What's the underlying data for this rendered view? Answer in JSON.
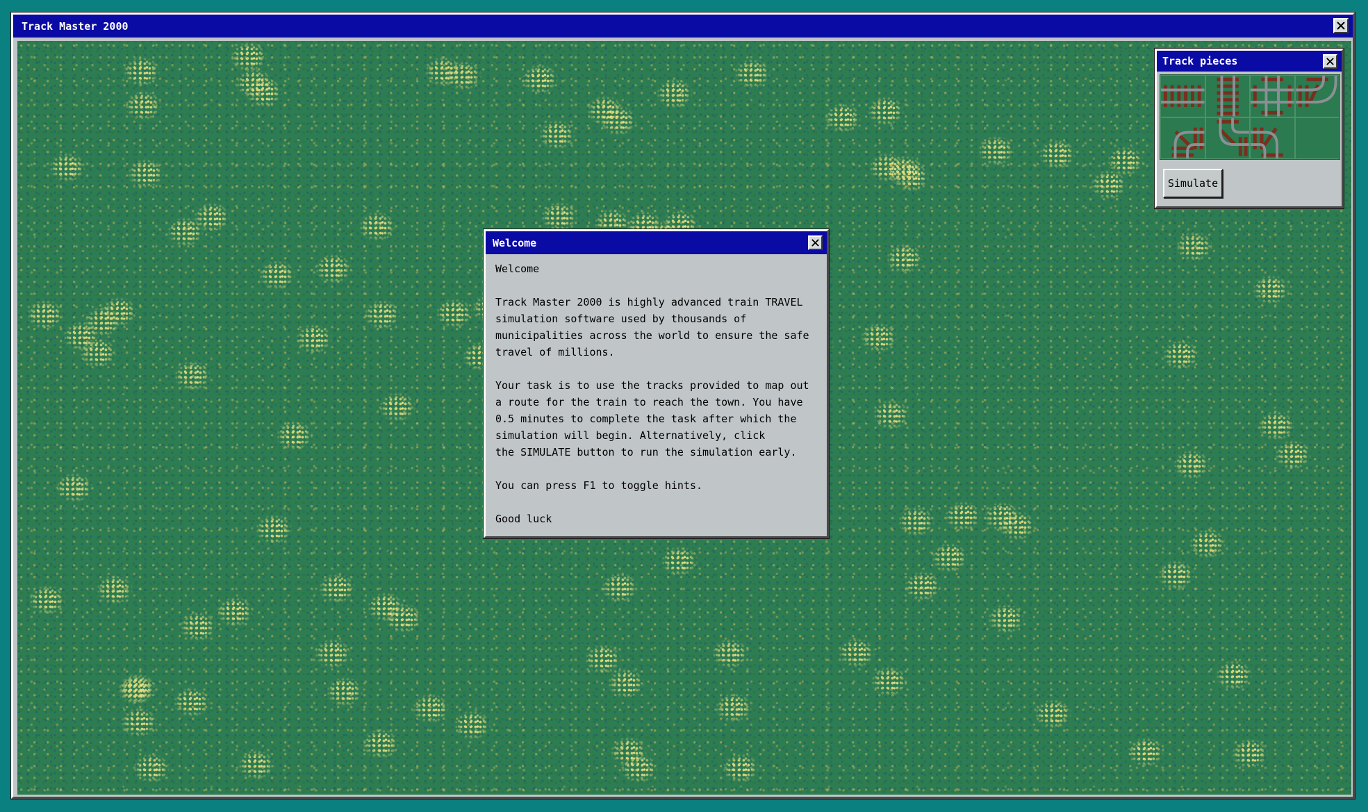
{
  "main_window": {
    "title": "Track Master 2000"
  },
  "palette": {
    "title": "Track pieces",
    "pieces": [
      {
        "name": "horizontal-track"
      },
      {
        "name": "vertical-track"
      },
      {
        "name": "cross-track"
      },
      {
        "name": "curve-left-down-track"
      },
      {
        "name": "curve-right-up-track"
      },
      {
        "name": "curve-up-right-track"
      },
      {
        "name": "curve-left-up-track"
      },
      {
        "name": "empty-slot"
      }
    ],
    "simulate_label": "Simulate"
  },
  "welcome_dialog": {
    "title": "Welcome",
    "paragraphs": [
      "Welcome",
      "Track Master 2000 is highly advanced train TRAVEL\nsimulation software used by thousands of\nmunicipalities across the world to ensure the safe\ntravel of millions.",
      "Your task is to use the tracks provided to map out\na route for the train to reach the town. You have\n0.5 minutes to complete the task after which the\nsimulation will begin. Alternatively, click\nthe SIMULATE button to run the simulation early.",
      "You can press F1 to toggle hints.",
      "Good luck"
    ]
  },
  "colors": {
    "desktop": "#0b8080",
    "titlebar": "#0a0aa4",
    "grass": "#2e7d52",
    "window_face": "#c0c6c8",
    "rail": "#8a9094",
    "sleeper": "#7a2e1e"
  }
}
